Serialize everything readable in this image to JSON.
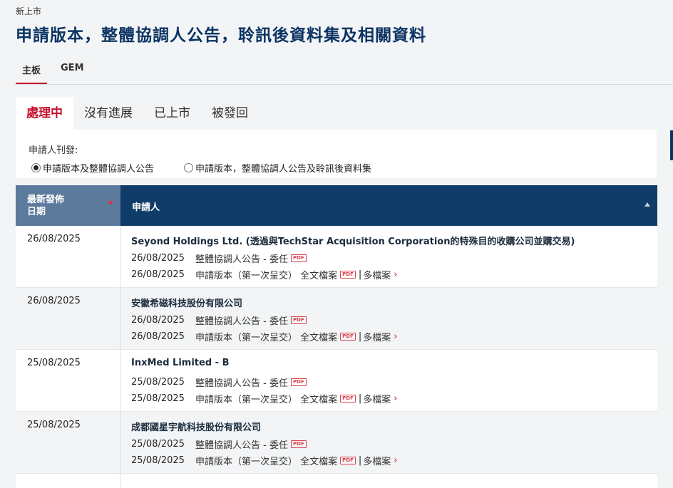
{
  "breadcrumb": "新上市",
  "page_title": "申請版本，整體協調人公告，聆訊後資料集及相關資料",
  "board_tabs": [
    {
      "label": "主板",
      "active": true
    },
    {
      "label": "GEM",
      "active": false
    }
  ],
  "status_tabs": [
    {
      "label": "處理中",
      "active": true
    },
    {
      "label": "沒有進展",
      "active": false
    },
    {
      "label": "已上市",
      "active": false
    },
    {
      "label": "被發回",
      "active": false
    }
  ],
  "filter": {
    "label": "申請人刊發:",
    "options": [
      {
        "label": "申請版本及整體協調人公告",
        "selected": true
      },
      {
        "label": "申請版本，整體協調人公告及聆訊後資料集",
        "selected": false
      }
    ]
  },
  "table": {
    "col_date": "最新發佈日期",
    "col_date_line1": "最新發佈",
    "col_date_line2": "日期",
    "col_applicant": "申請人",
    "pdf_badge": "PDF",
    "separator": "|",
    "more_files": "多檔案",
    "rows": [
      {
        "date": "26/08/2025",
        "company": "Seyond Holdings Ltd. (透過與TechStar Acquisition Corporation的特殊目的收購公司並購交易)",
        "doc1_date": "26/08/2025",
        "doc1_text": "整體協調人公告 - 委任",
        "doc2_date": "26/08/2025",
        "doc2_text": "申請版本（第一次呈交） 全文檔案"
      },
      {
        "date": "26/08/2025",
        "company": "安徽希磁科技股份有限公司",
        "doc1_date": "26/08/2025",
        "doc1_text": "整體協調人公告 - 委任",
        "doc2_date": "26/08/2025",
        "doc2_text": "申請版本（第一次呈交） 全文檔案"
      },
      {
        "date": "25/08/2025",
        "company": "InxMed Limited - B",
        "doc1_date": "25/08/2025",
        "doc1_text": "整體協調人公告 - 委任",
        "doc2_date": "25/08/2025",
        "doc2_text": "申請版本（第一次呈交） 全文檔案"
      },
      {
        "date": "25/08/2025",
        "company": "成都國星宇航科技股份有限公司",
        "doc1_date": "25/08/2025",
        "doc1_text": "整體協調人公告 - 委任",
        "doc2_date": "25/08/2025",
        "doc2_text": "申請版本（第一次呈交） 全文檔案"
      }
    ]
  },
  "colors": {
    "brand_navy": "#0c3463",
    "accent_red": "#c8102e",
    "header_bg": "#0f3c68",
    "sorted_col_bg": "#5c7a9c"
  }
}
